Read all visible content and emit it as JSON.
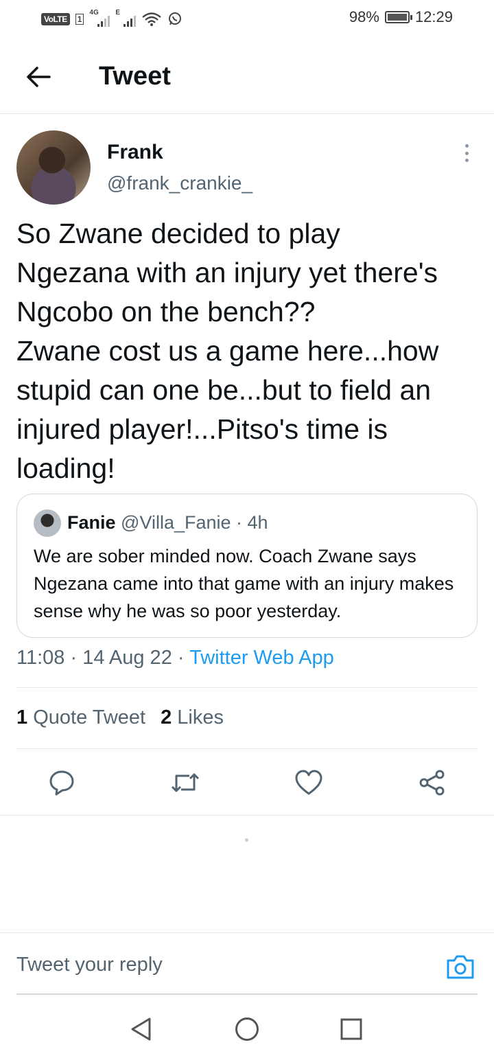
{
  "status_bar": {
    "volte": "VoLTE",
    "sim": "1",
    "net1": "4G",
    "net2": "E",
    "battery": "98%",
    "time": "12:29"
  },
  "header": {
    "title": "Tweet"
  },
  "tweet": {
    "author_name": "Frank",
    "author_handle": "@frank_crankie_",
    "text": "So Zwane decided to play\nNgezana with an injury yet there's\nNgcobo on the bench??\nZwane cost us a game here...how\nstupid can one be...but to field an\ninjured player!...Pitso's time is\nloading!",
    "quote": {
      "name": "Fanie",
      "meta": " @Villa_Fanie · 4h",
      "text": "We are sober minded now. Coach Zwane says Ngezana came into that game with an injury makes sense why he was so poor yesterday."
    },
    "timestamp": "11:08 · 14 Aug 22 · ",
    "source": "Twitter Web App",
    "stats": {
      "quote_count": "1",
      "quote_label": " Quote Tweet",
      "like_count": "2",
      "like_label": " Likes"
    }
  },
  "actions": [
    "reply-icon",
    "retweet-icon",
    "like-icon",
    "share-icon"
  ],
  "reply": {
    "placeholder": "Tweet your reply"
  },
  "colors": {
    "accent": "#1d9bf0",
    "text": "#0f1419",
    "muted": "#536471",
    "border": "#cfd9de"
  }
}
